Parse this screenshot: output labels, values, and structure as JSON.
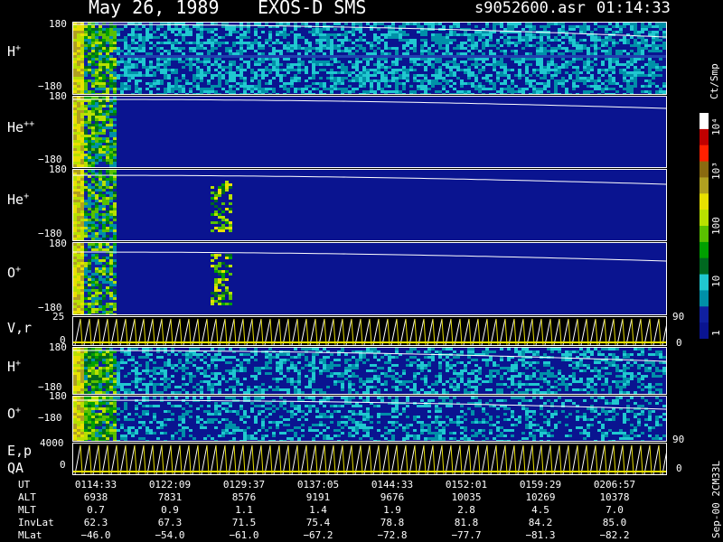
{
  "header": {
    "date": "May 26, 1989",
    "instrument": "EXOS-D SMS",
    "file": "s9052600.asr",
    "time": "01:14:33"
  },
  "panels": [
    {
      "label": "H",
      "sup": "+",
      "top_tick": "180",
      "bottom_tick": "−180"
    },
    {
      "label": "He",
      "sup": "++",
      "top_tick": "180",
      "bottom_tick": "−180"
    },
    {
      "label": "He",
      "sup": "+",
      "top_tick": "180",
      "bottom_tick": "−180"
    },
    {
      "label": "O",
      "sup": "+",
      "top_tick": "180",
      "bottom_tick": "−180"
    },
    {
      "label": "V,r",
      "sup": "",
      "top_tick": "25",
      "bottom_tick": "0",
      "right_top": "90",
      "right_bottom": "0"
    },
    {
      "label": "H",
      "sup": "+",
      "top_tick": "180",
      "bottom_tick": "−180"
    },
    {
      "label": "O",
      "sup": "+",
      "top_tick": "180",
      "bottom_tick": "−180"
    },
    {
      "label": "E,p",
      "sup": "",
      "label2": "QA",
      "top_tick": "4000",
      "bottom_tick": "0",
      "right_top": "90",
      "right_bottom": "0"
    }
  ],
  "colorbar": {
    "unit": "Ct/Smp",
    "ticks": [
      "10⁴",
      "10³",
      "100",
      "10",
      "1"
    ],
    "colors": [
      "#ffffff",
      "#c00000",
      "#ff2000",
      "#8a6a10",
      "#b0a020",
      "#e8e000",
      "#b8e000",
      "#5ac000",
      "#00a000",
      "#006820",
      "#20c8d0",
      "#0090a8",
      "#1020a0",
      "#0a1490"
    ]
  },
  "footer": {
    "rows": [
      {
        "label": "UT",
        "values": [
          "0114:33",
          "0122:09",
          "0129:37",
          "0137:05",
          "0144:33",
          "0152:01",
          "0159:29",
          "0206:57"
        ]
      },
      {
        "label": "ALT",
        "values": [
          "6938",
          "7831",
          "8576",
          "9191",
          "9676",
          "10035",
          "10269",
          "10378"
        ]
      },
      {
        "label": "MLT",
        "values": [
          "0.7",
          "0.9",
          "1.1",
          "1.4",
          "1.9",
          "2.8",
          "4.5",
          "7.0"
        ]
      },
      {
        "label": "InvLat",
        "values": [
          "62.3",
          "67.3",
          "71.5",
          "75.4",
          "78.8",
          "81.8",
          "84.2",
          "85.0"
        ]
      },
      {
        "label": "MLat",
        "values": [
          "−46.0",
          "−54.0",
          "−61.0",
          "−67.2",
          "−72.8",
          "−77.7",
          "−81.3",
          "−82.2"
        ]
      }
    ],
    "side_label": "Sep-00 2CM33L"
  },
  "chart_data": {
    "type": "heatmap",
    "title": "May 26, 1989   EXOS-D SMS",
    "x": [
      "0114:33",
      "0122:09",
      "0129:37",
      "0137:05",
      "0144:33",
      "0152:01",
      "0159:29",
      "0206:57"
    ],
    "series": [
      {
        "name": "H+"
      },
      {
        "name": "He++"
      },
      {
        "name": "He+"
      },
      {
        "name": "O+"
      },
      {
        "name": "V,r"
      },
      {
        "name": "H+"
      },
      {
        "name": "O+"
      },
      {
        "name": "E,p"
      }
    ],
    "ylim": [
      -180,
      180
    ],
    "colorscale": {
      "unit": "Ct/Smp",
      "range": [
        1,
        10000
      ],
      "scale": "log"
    }
  }
}
